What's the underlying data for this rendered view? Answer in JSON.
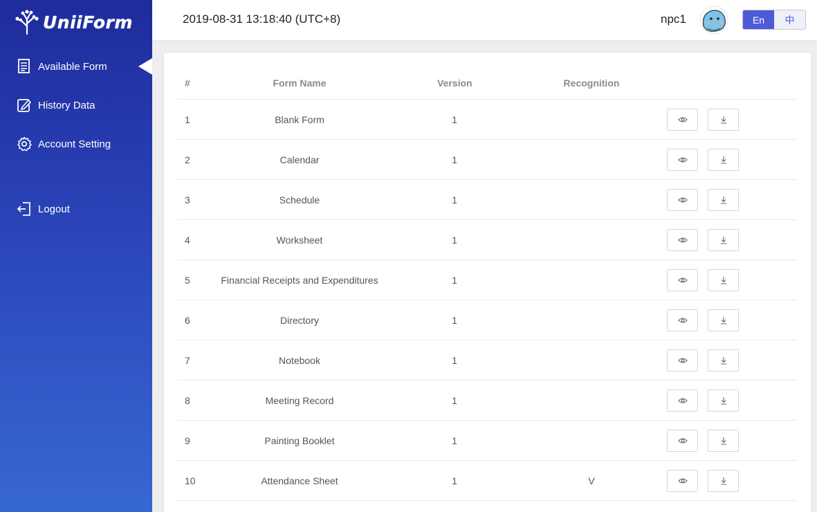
{
  "sidebar": {
    "logo_text": "UniiForm",
    "nav": [
      {
        "label": "Available Form",
        "icon": "document-icon",
        "active": true
      },
      {
        "label": "History Data",
        "icon": "edit-icon",
        "active": false
      },
      {
        "label": "Account Setting",
        "icon": "gear-icon",
        "active": false
      },
      {
        "label": "Logout",
        "icon": "logout-icon",
        "active": false
      }
    ]
  },
  "header": {
    "datetime": "2019-08-31 13:18:40 (UTC+8)",
    "username": "npc1",
    "lang": {
      "en": "En",
      "zh": "中"
    }
  },
  "table": {
    "headers": {
      "num": "#",
      "name": "Form Name",
      "version": "Version",
      "recognition": "Recognition"
    },
    "rows": [
      {
        "num": "1",
        "name": "Blank Form",
        "version": "1",
        "recognition": ""
      },
      {
        "num": "2",
        "name": "Calendar",
        "version": "1",
        "recognition": ""
      },
      {
        "num": "3",
        "name": "Schedule",
        "version": "1",
        "recognition": ""
      },
      {
        "num": "4",
        "name": "Worksheet",
        "version": "1",
        "recognition": ""
      },
      {
        "num": "5",
        "name": "Financial Receipts and Expenditures",
        "version": "1",
        "recognition": ""
      },
      {
        "num": "6",
        "name": "Directory",
        "version": "1",
        "recognition": ""
      },
      {
        "num": "7",
        "name": "Notebook",
        "version": "1",
        "recognition": ""
      },
      {
        "num": "8",
        "name": "Meeting Record",
        "version": "1",
        "recognition": ""
      },
      {
        "num": "9",
        "name": "Painting Booklet",
        "version": "1",
        "recognition": ""
      },
      {
        "num": "10",
        "name": "Attendance Sheet",
        "version": "1",
        "recognition": "V"
      }
    ]
  },
  "colors": {
    "sidebar_top": "#1e2b9c",
    "sidebar_bottom": "#3768d2",
    "accent": "#4e5bd6"
  }
}
